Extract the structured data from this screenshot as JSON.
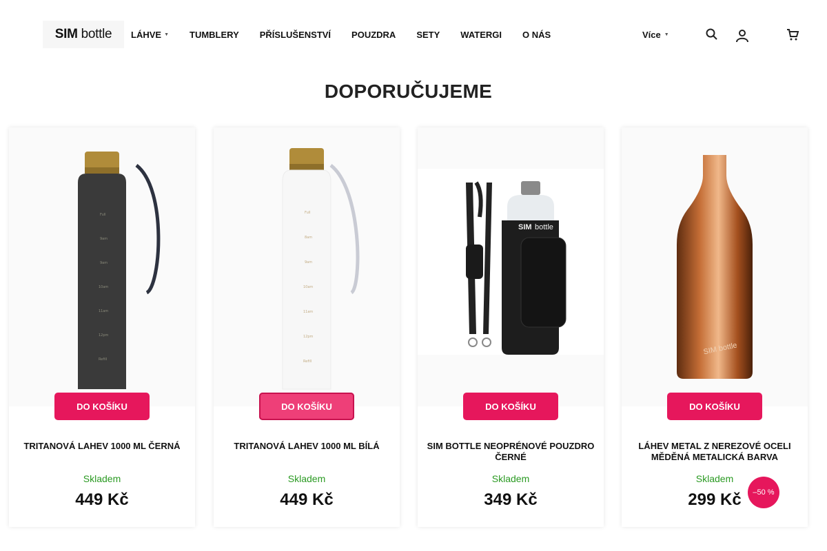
{
  "header": {
    "logo": {
      "bold": "SIM",
      "rest": " bottle"
    },
    "nav": [
      {
        "label": "LÁHVE",
        "has_caret": true
      },
      {
        "label": "TUMBLERY",
        "has_caret": false
      },
      {
        "label": "PŘÍSLUŠENSTVÍ",
        "has_caret": false
      },
      {
        "label": "POUZDRA",
        "has_caret": false
      },
      {
        "label": "SETY",
        "has_caret": false
      },
      {
        "label": "WATERGI",
        "has_caret": false
      },
      {
        "label": "O NÁS",
        "has_caret": false
      }
    ],
    "more_label": "Více",
    "icons": [
      "search-icon",
      "user-icon",
      "cart-icon"
    ]
  },
  "section_title": "DOPORUČUJEME",
  "products": [
    {
      "name": "TRITANOVÁ LAHEV 1000 ML ČERNÁ",
      "button": "DO KOŠÍKU",
      "stock": "Skladem",
      "price": "449 Kč",
      "image": "black-tritan-bottle",
      "discount": ""
    },
    {
      "name": "TRITANOVÁ LAHEV 1000 ML BÍLÁ",
      "button": "DO KOŠÍKU",
      "stock": "Skladem",
      "price": "449 Kč",
      "image": "white-tritan-bottle",
      "discount": ""
    },
    {
      "name": "SIM BOTTLE NEOPRÉNOVÉ POUZDRO ČERNÉ",
      "button": "DO KOŠÍKU",
      "stock": "Skladem",
      "price": "349 Kč",
      "image": "neoprene-sleeve",
      "discount": ""
    },
    {
      "name": "LÁHEV METAL Z NEREZOVÉ OCELI MĚDĚNÁ METALICKÁ BARVA",
      "button": "DO KOŠÍKU",
      "stock": "Skladem",
      "price": "299 Kč",
      "image": "copper-bottle",
      "discount": "–50 %"
    }
  ],
  "colors": {
    "accent": "#e6175c",
    "stock": "#2a9a22"
  }
}
